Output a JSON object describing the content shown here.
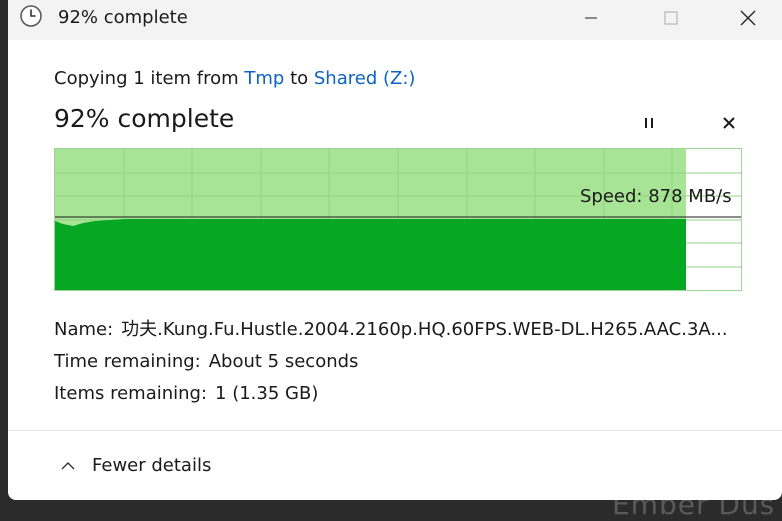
{
  "window": {
    "title": "92% complete"
  },
  "copy": {
    "prefix": "Copying 1 item from ",
    "source": "Tmp",
    "mid": " to ",
    "destination": "Shared (Z:)",
    "percent_text": "92% complete",
    "progress_fraction": 0.92
  },
  "graph": {
    "speed_text": "Speed: 878 MB/s",
    "fill_color": "#06a823",
    "background_fill_color": "#a8e496"
  },
  "details": {
    "name_label": "Name:",
    "name_value": "功夫.Kung.Fu.Hustle.2004.2160p.HQ.60FPS.WEB-DL.H265.AAC.3A...",
    "time_label": "Time remaining:",
    "time_value": "About 5 seconds",
    "items_label": "Items remaining:",
    "items_value": "1 (1.35 GB)"
  },
  "footer": {
    "toggle_label": "Fewer details"
  },
  "background": {
    "partial_text": "Ember Dus"
  }
}
